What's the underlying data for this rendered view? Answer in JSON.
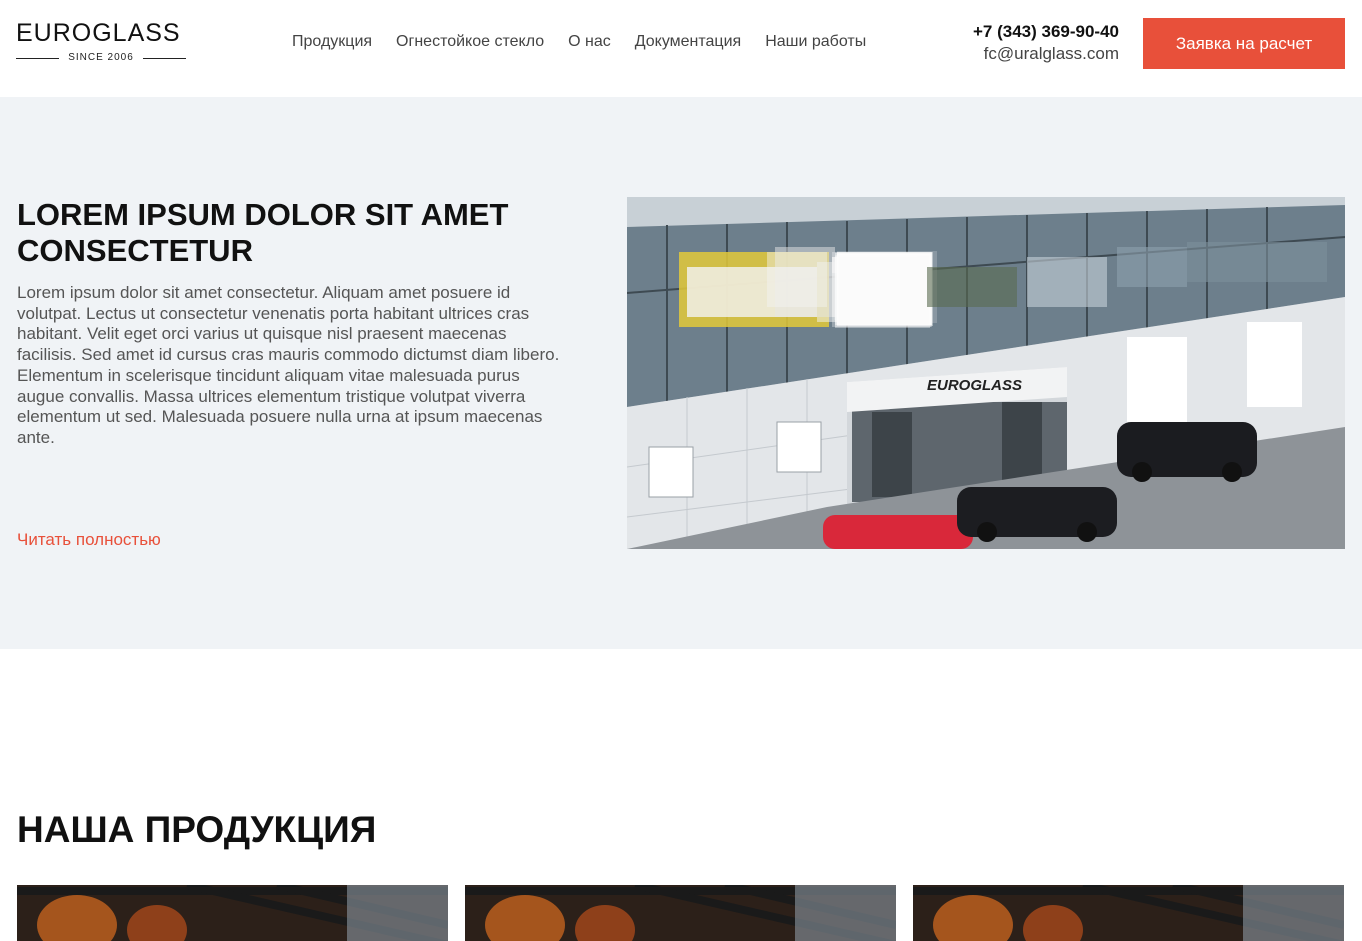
{
  "header": {
    "logo": {
      "name": "EUROGLASS",
      "since": "SINCE 2006"
    },
    "nav": [
      "Продукция",
      "Огнестойкое стекло",
      "О нас",
      "Документация",
      "Наши работы"
    ],
    "phone": "+7 (343) 369-90-40",
    "email": "fc@uralglass.com",
    "cta_label": "Заявка на расчет"
  },
  "hero": {
    "title": "LOREM IPSUM DOLOR SIT AMET CONSECTETUR",
    "text": "Lorem ipsum dolor sit amet consectetur. Aliquam amet posuere id volutpat. Lectus ut consectetur venenatis porta habitant ultrices cras habitant. Velit eget orci varius ut quisque nisl praesent maecenas facilisis. Sed amet id cursus cras mauris commodo dictumst diam libero. Elementum in scelerisque tincidunt aliquam vitae malesuada purus augue convallis. Massa ultrices elementum tristique volutpat viverra elementum ut sed. Malesuada posuere nulla urna at ipsum maecenas ante.",
    "read_more": "Читать полностью",
    "photo_sign": "EUROGLASS"
  },
  "products": {
    "title": "НАША ПРОДУКЦИЯ"
  },
  "colors": {
    "accent": "#e8503a",
    "hero_bg": "#f0f3f6",
    "text_dark": "#111111",
    "text_muted": "#555555"
  }
}
